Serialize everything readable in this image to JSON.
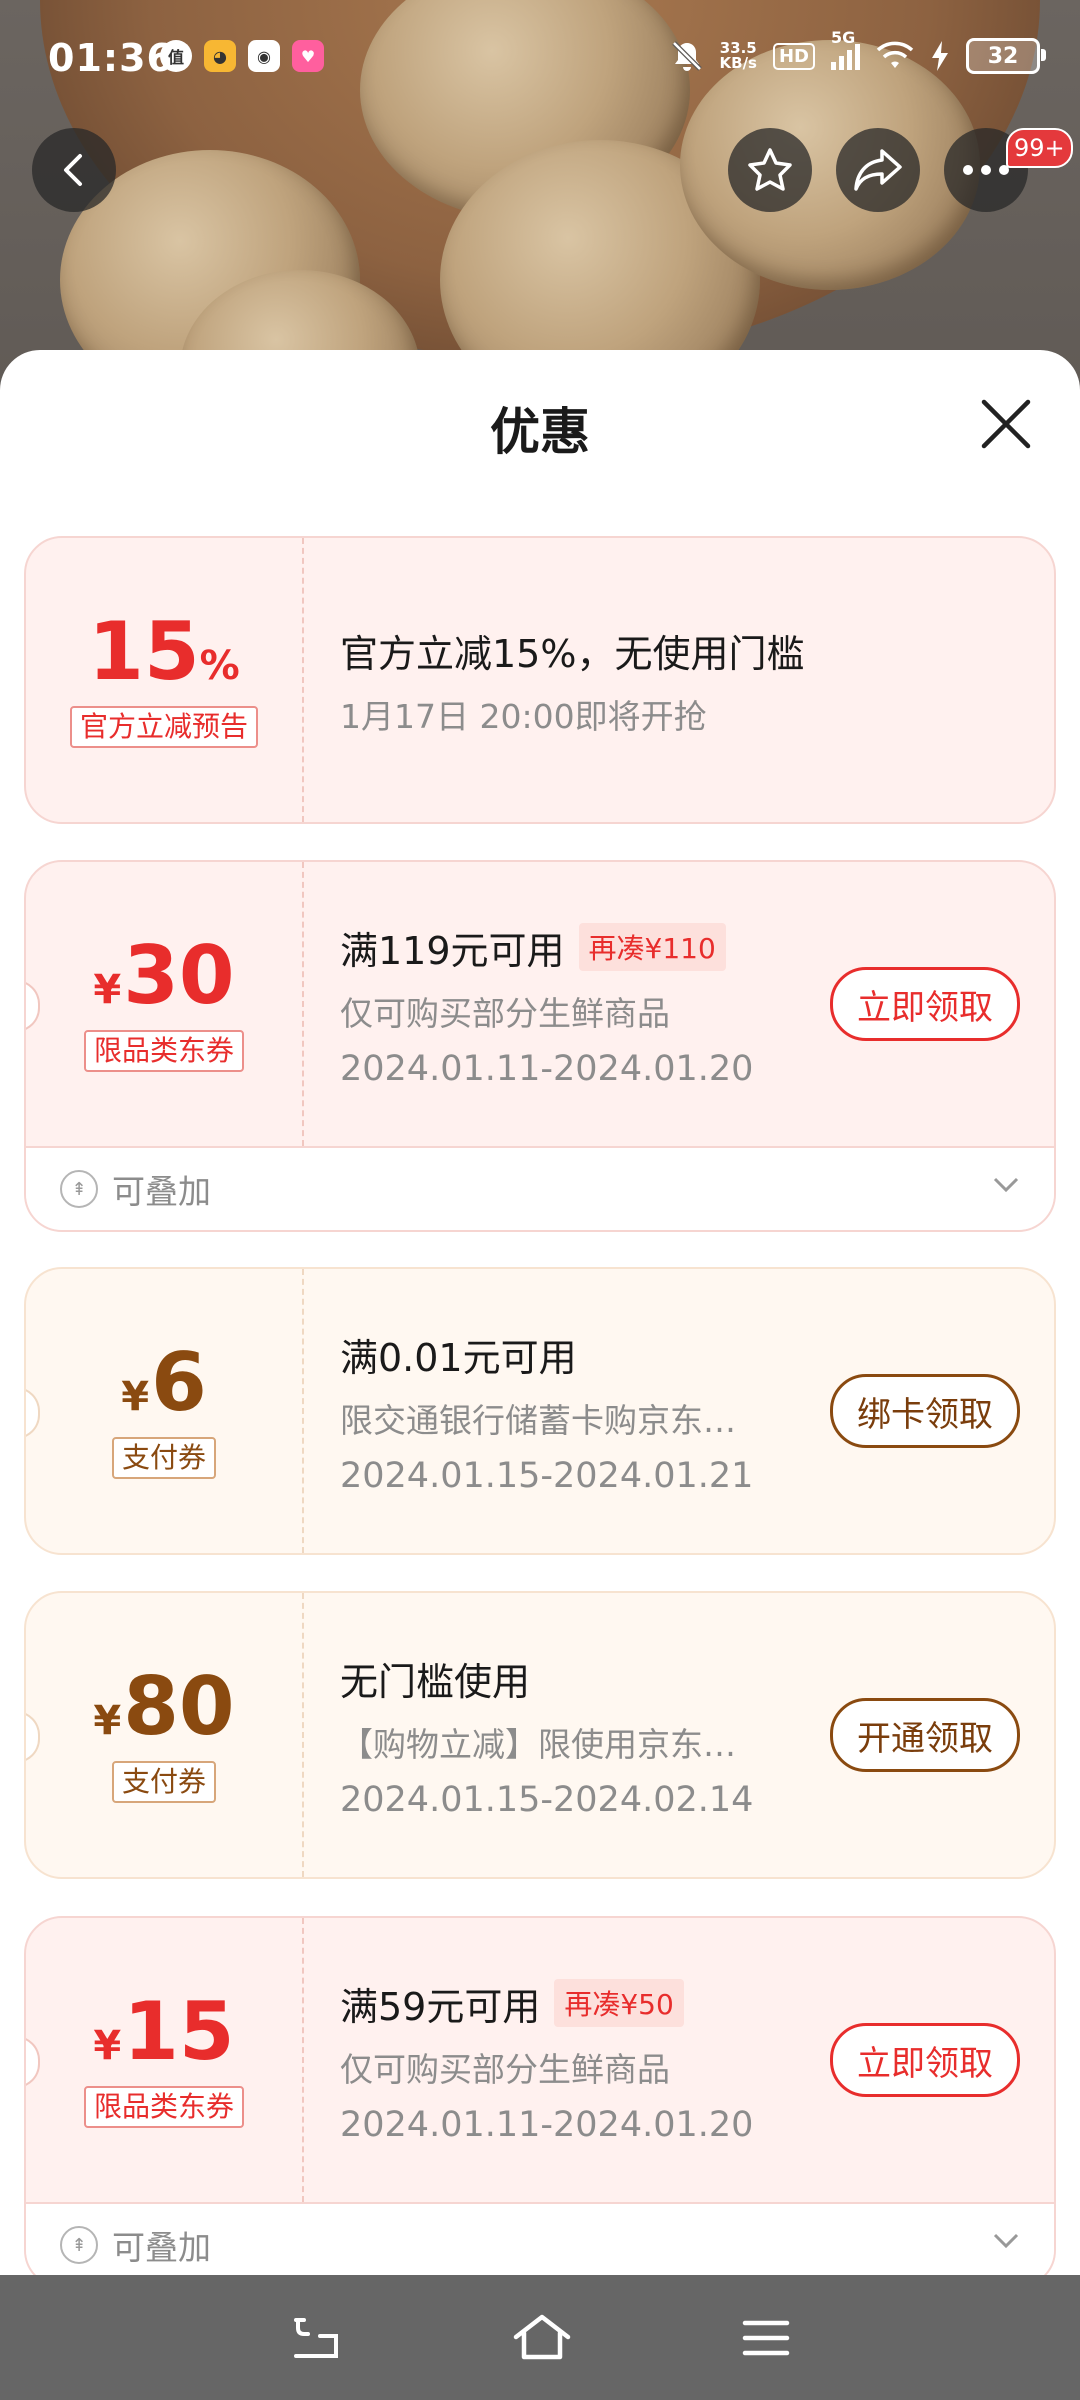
{
  "status_bar": {
    "time": "01:36",
    "net_speed_value": "33.5",
    "net_speed_unit": "KB/s",
    "hd": "HD",
    "network": "5G",
    "battery": "32"
  },
  "header": {
    "more_badge": "99+"
  },
  "sheet": {
    "title": "优惠"
  },
  "coupons": [
    {
      "amount": "15",
      "amount_suffix": "%",
      "tag": "官方立减预告",
      "line1": "官方立减15%，无使用门槛",
      "line2": "1月17日 20:00即将开抢"
    },
    {
      "currency": "¥",
      "amount": "30",
      "tag": "限品类东券",
      "line1": "满119元可用",
      "extra": "再凑¥110",
      "line2": "仅可购买部分生鲜商品",
      "line3": "2024.01.11-2024.01.20",
      "action": "立即领取",
      "stack": "可叠加"
    },
    {
      "currency": "¥",
      "amount": "6",
      "tag": "支付券",
      "line1": "满0.01元可用",
      "line2": "限交通银行储蓄卡购京东…",
      "line3": "2024.01.15-2024.01.21",
      "action": "绑卡领取"
    },
    {
      "currency": "¥",
      "amount": "80",
      "tag": "支付券",
      "line1": "无门槛使用",
      "line2": "【购物立减】限使用京东…",
      "line3": "2024.01.15-2024.02.14",
      "action": "开通领取"
    },
    {
      "currency": "¥",
      "amount": "15",
      "tag": "限品类东券",
      "line1": "满59元可用",
      "extra": "再凑¥50",
      "line2": "仅可购买部分生鲜商品",
      "line3": "2024.01.11-2024.01.20",
      "action": "立即领取",
      "stack": "可叠加"
    }
  ],
  "colors": {
    "accent_red": "#e82d2c",
    "accent_brown": "#8a4a10"
  },
  "icons": [
    "back-icon",
    "star-icon",
    "share-icon",
    "more-icon",
    "close-icon",
    "stack-icon",
    "chevron-down-icon",
    "nav-back-icon",
    "nav-home-icon",
    "nav-menu-icon"
  ]
}
